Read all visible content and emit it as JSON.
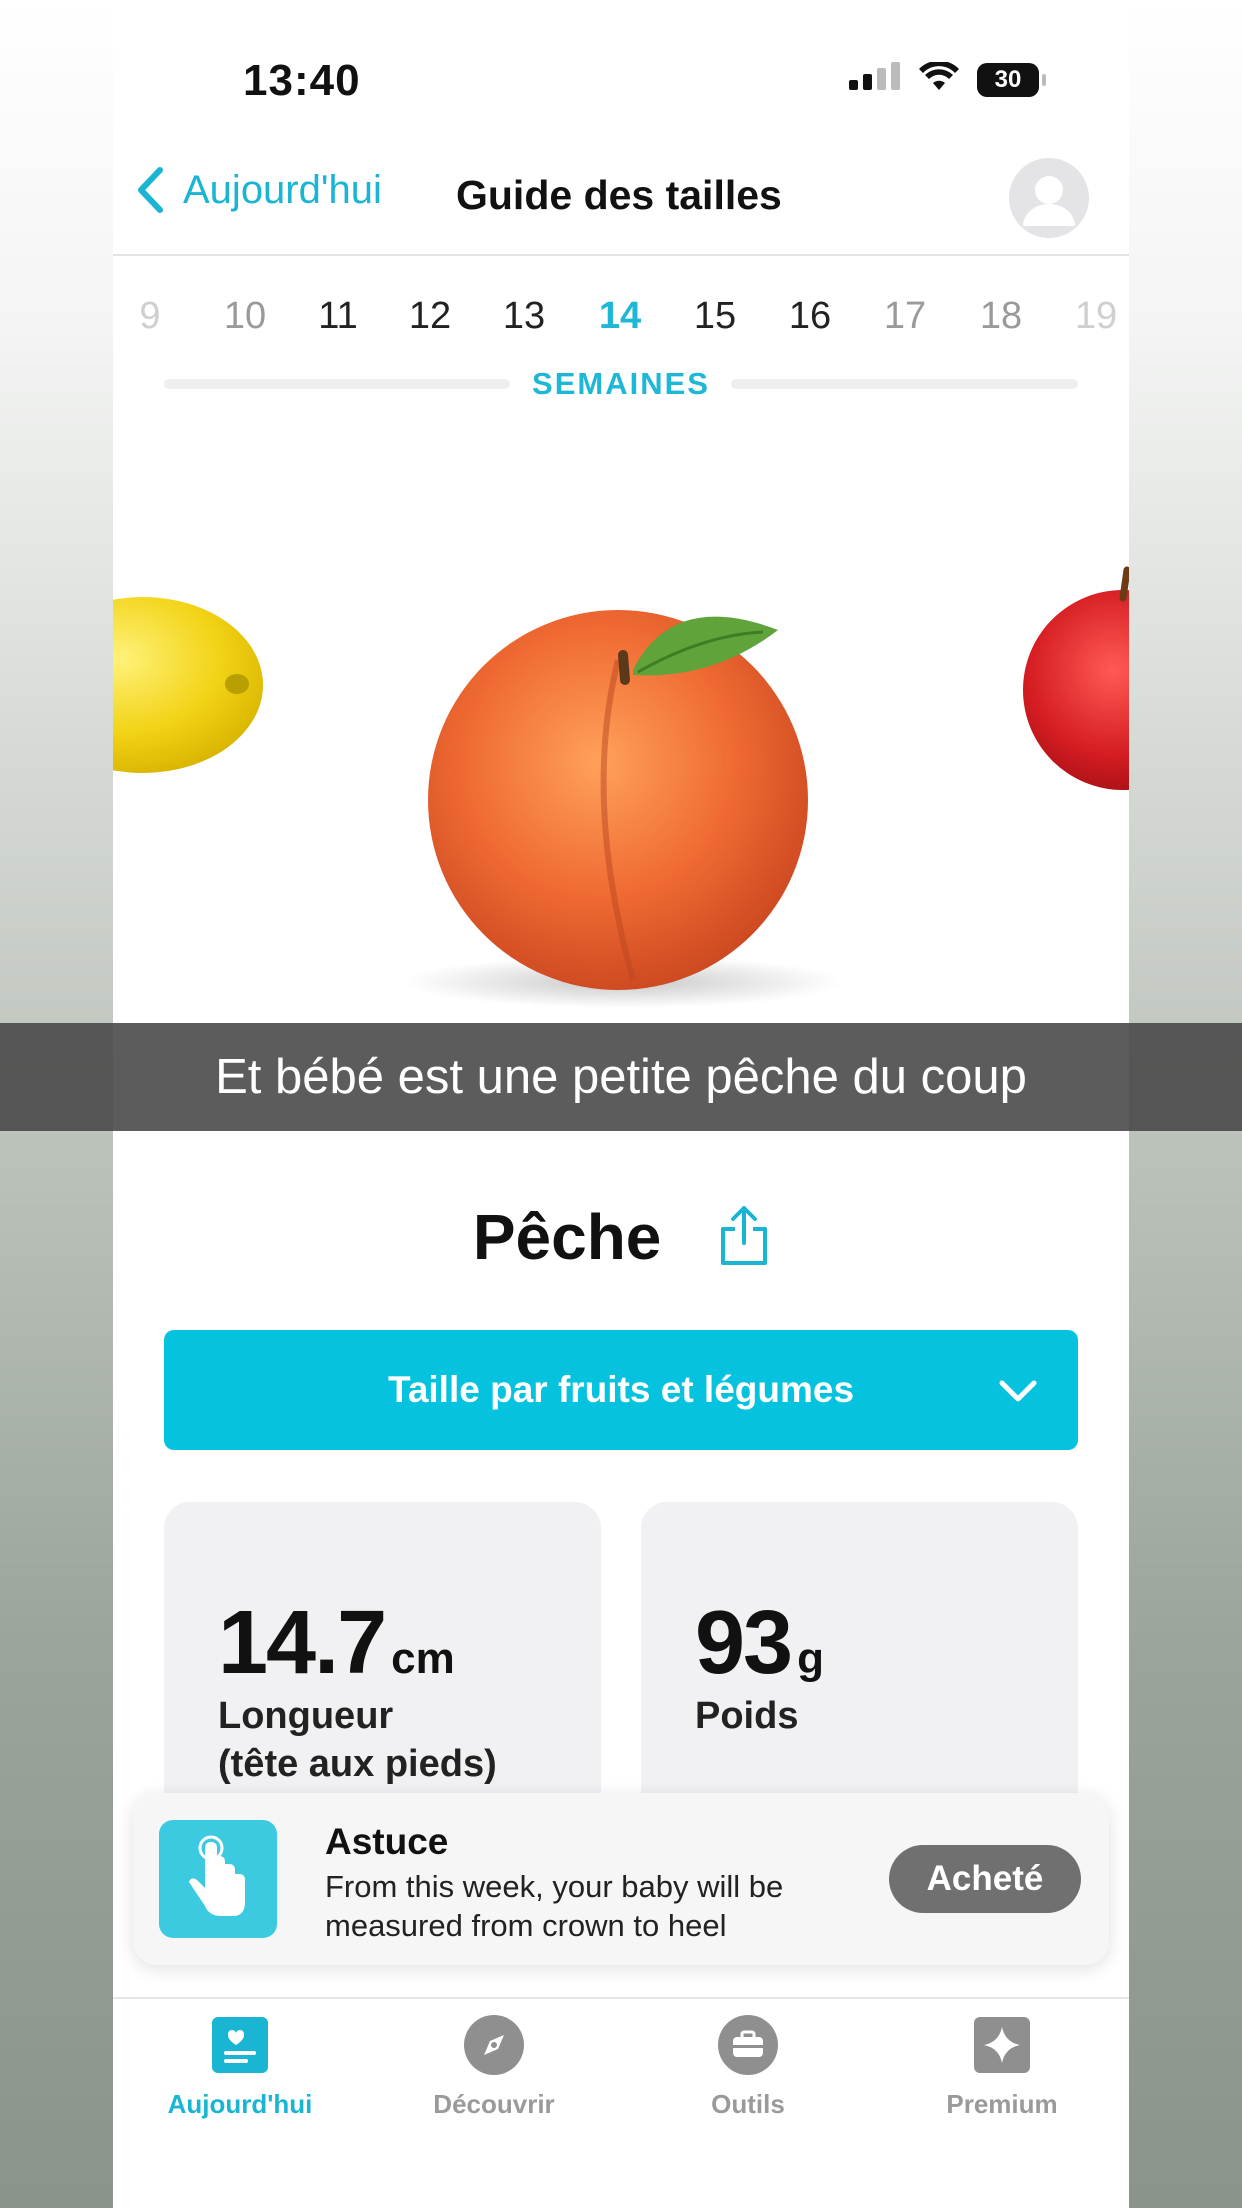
{
  "status": {
    "time": "13:40",
    "battery": "30"
  },
  "nav": {
    "back_label": "Aujourd'hui",
    "title": "Guide des tailles"
  },
  "weeks": {
    "items": [
      "9",
      "10",
      "11",
      "12",
      "13",
      "14",
      "15",
      "16",
      "17",
      "18",
      "19"
    ],
    "selected": "14",
    "label": "SEMAINES"
  },
  "caption": "Et bébé est une petite pêche du coup",
  "fruit": {
    "name": "Pêche"
  },
  "dropdown": {
    "label": "Taille par fruits et légumes"
  },
  "stats": {
    "length": {
      "value": "14.7",
      "unit": "cm",
      "label_line1": "Longueur",
      "label_line2": "(tête aux pieds)"
    },
    "weight": {
      "value": "93",
      "unit": "g",
      "label": "Poids"
    }
  },
  "tip": {
    "title": "Astuce",
    "text": "From this week, your baby will be measured from crown to heel",
    "button": "Acheté"
  },
  "tabs": [
    {
      "label": "Aujourd'hui",
      "icon": "calendar-heart-icon",
      "active": true
    },
    {
      "label": "Découvrir",
      "icon": "compass-icon",
      "active": false
    },
    {
      "label": "Outils",
      "icon": "briefcase-icon",
      "active": false
    },
    {
      "label": "Premium",
      "icon": "sparkle-icon",
      "active": false
    }
  ],
  "colors": {
    "accent": "#1cb8d6",
    "dropdown": "#05c3df",
    "tip_button": "#707070"
  }
}
